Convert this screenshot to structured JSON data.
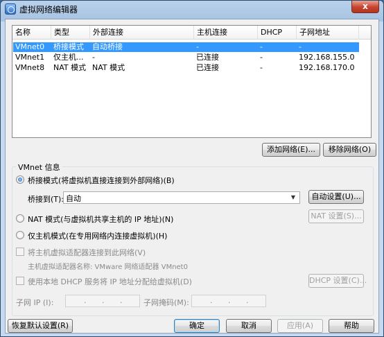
{
  "window": {
    "title": "虚拟网络编辑器",
    "close_label": "x"
  },
  "table": {
    "columns": [
      "名称",
      "类型",
      "外部连接",
      "主机连接",
      "DHCP",
      "子网地址"
    ],
    "rows": [
      [
        "VMnet0",
        "桥接模式",
        "自动桥接",
        "-",
        "-",
        "-"
      ],
      [
        "VMnet1",
        "仅主机...",
        "-",
        "已连接",
        "-",
        "192.168.155.0"
      ],
      [
        "VMnet8",
        "NAT 模式",
        "NAT 模式",
        "已连接",
        "-",
        "192.168.170.0"
      ]
    ],
    "selected_row": 0
  },
  "list_buttons": {
    "add": "添加网络(E)...",
    "remove": "移除网络(O)"
  },
  "vmnet_info": {
    "title": "VMnet 信息",
    "bridge_option": "桥接模式(将虚拟机直接连接到外部网络)(B)",
    "bridge_to_label": "桥接到(T):",
    "bridge_to_value": "自动",
    "auto_settings": "自动设置(U)...",
    "nat_option": "NAT 模式(与虚拟机共享主机的 IP 地址)(N)",
    "nat_settings": "NAT 设置(S)...",
    "hostonly_option": "仅主机模式(在专用网络内连接虚拟机)(H)",
    "connect_adapter": "将主机虚拟适配器连接到此网络(V)",
    "adapter_name": "主机虚拟适配器名称: VMware 网络适配器 VMnet0",
    "use_dhcp": "使用本地 DHCP 服务将 IP 地址分配给虚拟机(D)",
    "dhcp_settings": "DHCP 设置(C)...",
    "subnet_ip_label": "子网 IP (I):",
    "subnet_mask_label": "子网掩码(M):",
    "ip_dot": "."
  },
  "footer": {
    "restore": "恢复默认设置(R)",
    "ok": "确定",
    "cancel": "取消",
    "apply": "应用(A)",
    "help": "帮助"
  }
}
